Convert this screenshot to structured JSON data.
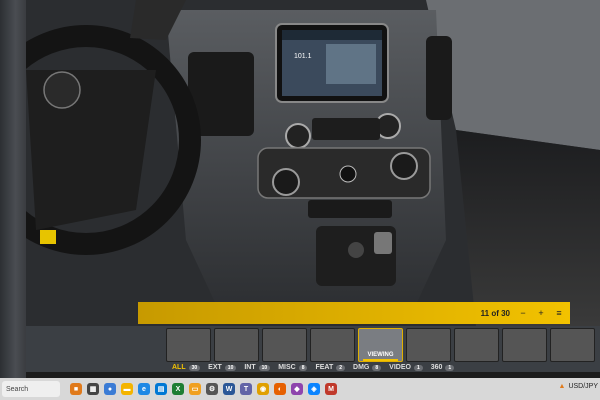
{
  "photo": {
    "screen_station": "101.1",
    "counter": "11 of 30"
  },
  "thumbnails": [
    {
      "label": ""
    },
    {
      "label": ""
    },
    {
      "label": ""
    },
    {
      "label": ""
    },
    {
      "label": "VIEWING",
      "active": true
    },
    {
      "label": ""
    },
    {
      "label": ""
    },
    {
      "label": ""
    },
    {
      "label": ""
    }
  ],
  "filters": [
    {
      "label": "ALL",
      "count": "30",
      "active": true
    },
    {
      "label": "EXT",
      "count": "10"
    },
    {
      "label": "INT",
      "count": "10"
    },
    {
      "label": "MISC",
      "count": "8"
    },
    {
      "label": "FEAT",
      "count": "2"
    },
    {
      "label": "DMG",
      "count": "8"
    },
    {
      "label": "VIDEO",
      "count": "1"
    },
    {
      "label": "360",
      "count": "1"
    }
  ],
  "taskbar": {
    "search_label": "Search",
    "tray_text": "USD/JPY"
  },
  "colors": {
    "accent": "#f2c200",
    "panel": "#3b3f44"
  }
}
